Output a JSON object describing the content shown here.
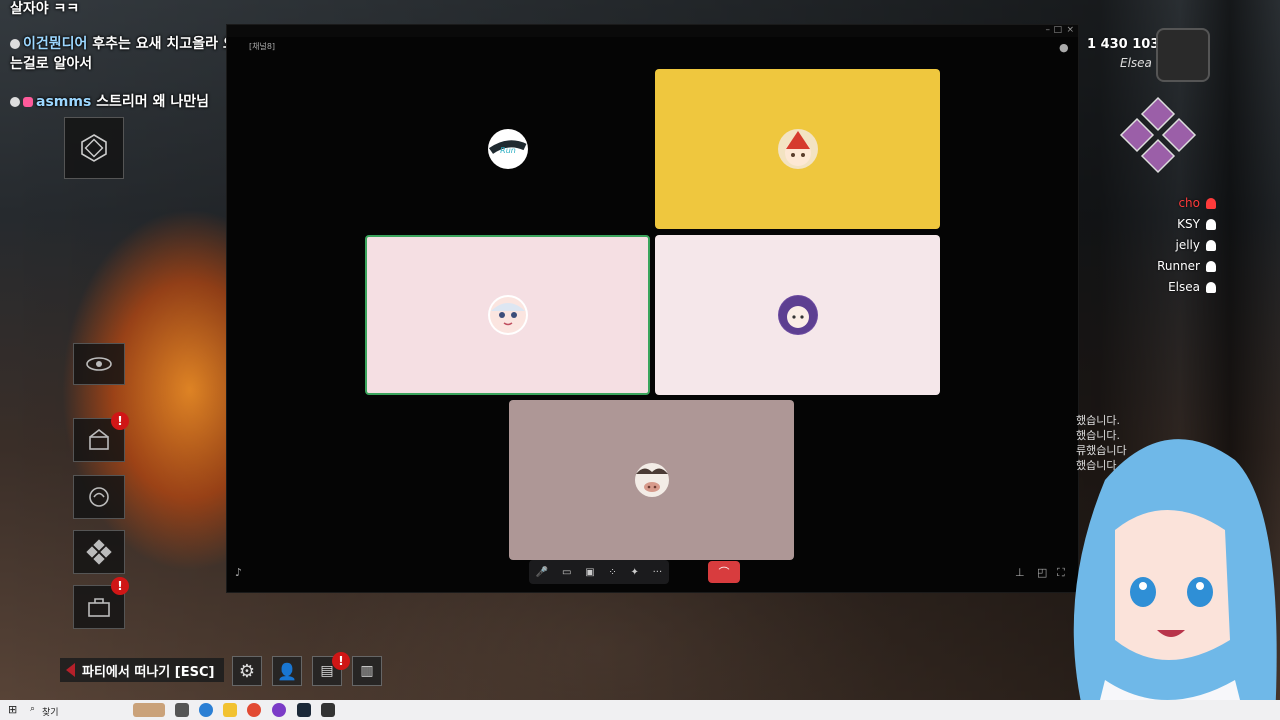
{
  "chat": [
    {
      "user": "",
      "text": "살자야 ㅋㅋ"
    },
    {
      "user": "이건뭔디어",
      "text": "후추는 요새 치고올라 오는걸로 알아서"
    },
    {
      "user": "asmms",
      "text": "스트리머 왜 나만님"
    }
  ],
  "discord": {
    "channel_label": "[채널8]",
    "participants": [
      {
        "name": "Run Aura",
        "bg": "#0f1c1e"
      },
      {
        "name": "Elf",
        "bg": "#efc73e"
      },
      {
        "name": "Chibi",
        "bg": "#f5dfe3"
      },
      {
        "name": "Girl",
        "bg": "#f5e7ea"
      },
      {
        "name": "Cow",
        "bg": "#ae9796"
      }
    ],
    "controls": {
      "mic": "mic-icon",
      "camera": "camera-icon",
      "screen": "screen-share-icon",
      "activities": "activities-icon",
      "effects": "effects-icon",
      "more": "···",
      "hangup": "hangup-icon"
    }
  },
  "hud": {
    "score": "1 430 103",
    "score_player": "Elsea",
    "players": [
      {
        "name": "cho",
        "color": "#ff3b3b"
      },
      {
        "name": "KSY",
        "color": "#ffffff"
      },
      {
        "name": "jelly",
        "color": "#ffffff"
      },
      {
        "name": "Runner",
        "color": "#ffffff"
      },
      {
        "name": "Elsea",
        "color": "#ffffff"
      }
    ],
    "log_lines": [
      "했습니다.",
      "했습니다.",
      "류했습니다",
      "했습니다."
    ],
    "leave_party": "파티에서 떠나기 [ESC]"
  },
  "taskbar": {
    "search": "찾기"
  }
}
